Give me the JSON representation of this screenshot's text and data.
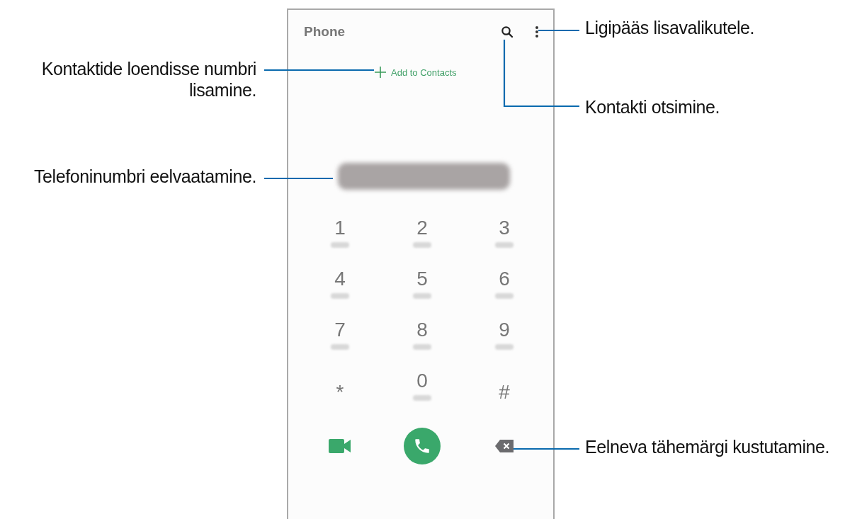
{
  "phone_screen": {
    "title": "Phone",
    "add_contact": {
      "label": "Add to Contacts"
    },
    "keypad": [
      {
        "key": "1",
        "kind": "digit"
      },
      {
        "key": "2",
        "kind": "digit"
      },
      {
        "key": "3",
        "kind": "digit"
      },
      {
        "key": "4",
        "kind": "digit"
      },
      {
        "key": "5",
        "kind": "digit"
      },
      {
        "key": "6",
        "kind": "digit"
      },
      {
        "key": "7",
        "kind": "digit"
      },
      {
        "key": "8",
        "kind": "digit"
      },
      {
        "key": "9",
        "kind": "digit"
      },
      {
        "key": "*",
        "kind": "symbol"
      },
      {
        "key": "0",
        "kind": "digit"
      },
      {
        "key": "#",
        "kind": "symbol"
      }
    ]
  },
  "callouts": [
    {
      "text": "Ligipääs lisavalikutele."
    },
    {
      "text": "Kontaktide loendisse numbri lisamine."
    },
    {
      "text": "Kontakti otsimine."
    },
    {
      "text": "Telefoninumbri eelvaatamine."
    },
    {
      "text": "Eelneva tähemärgi kustutamine."
    }
  ]
}
